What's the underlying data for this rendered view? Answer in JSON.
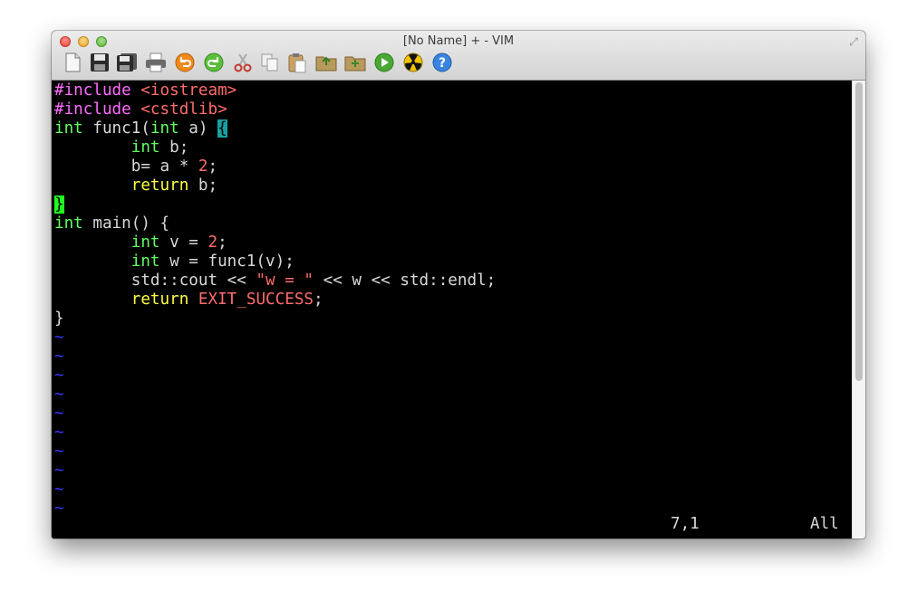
{
  "window": {
    "title": "[No Name] + - VIM"
  },
  "toolbar": {
    "buttons": [
      {
        "name": "new-file-icon"
      },
      {
        "name": "save-icon"
      },
      {
        "name": "save-all-icon"
      },
      {
        "name": "print-icon"
      },
      {
        "name": "undo-icon"
      },
      {
        "name": "redo-icon"
      },
      {
        "name": "cut-icon"
      },
      {
        "name": "copy-icon"
      },
      {
        "name": "paste-icon"
      },
      {
        "name": "open-folder-icon"
      },
      {
        "name": "new-folder-icon"
      },
      {
        "name": "run-icon"
      },
      {
        "name": "radiation-icon"
      },
      {
        "name": "help-icon"
      }
    ]
  },
  "editor": {
    "lines": [
      {
        "t": "l1a",
        "v": "#include"
      },
      {
        "t": "l1b",
        "v": " <iostream>"
      },
      {
        "t": "l2a",
        "v": "#include"
      },
      {
        "t": "l2b",
        "v": " <cstdlib>"
      },
      {
        "t": "l3a",
        "v": "int"
      },
      {
        "t": "l3b",
        "v": " func1("
      },
      {
        "t": "l3c",
        "v": "int"
      },
      {
        "t": "l3d",
        "v": " a) "
      },
      {
        "t": "l3e",
        "v": "{"
      },
      {
        "t": "l4a",
        "v": "        "
      },
      {
        "t": "l4b",
        "v": "int"
      },
      {
        "t": "l4c",
        "v": " b;"
      },
      {
        "t": "l5a",
        "v": "        b= a * "
      },
      {
        "t": "l5b",
        "v": "2"
      },
      {
        "t": "l5c",
        "v": ";"
      },
      {
        "t": "l6a",
        "v": "        "
      },
      {
        "t": "l6b",
        "v": "return"
      },
      {
        "t": "l6c",
        "v": " b;"
      },
      {
        "t": "l7a",
        "v": "}"
      },
      {
        "t": "l8a",
        "v": "int"
      },
      {
        "t": "l8b",
        "v": " main() {"
      },
      {
        "t": "l9a",
        "v": "        "
      },
      {
        "t": "l9b",
        "v": "int"
      },
      {
        "t": "l9c",
        "v": " v = "
      },
      {
        "t": "l9d",
        "v": "2"
      },
      {
        "t": "l9e",
        "v": ";"
      },
      {
        "t": "l10a",
        "v": "        "
      },
      {
        "t": "l10b",
        "v": "int"
      },
      {
        "t": "l10c",
        "v": " w = func1(v);"
      },
      {
        "t": "l11a",
        "v": "        std::cout << "
      },
      {
        "t": "l11b",
        "v": "\"w = \""
      },
      {
        "t": "l11c",
        "v": " << w << std::endl;"
      },
      {
        "t": "l12a",
        "v": "        "
      },
      {
        "t": "l12b",
        "v": "return"
      },
      {
        "t": "l12c",
        "v": " "
      },
      {
        "t": "l12d",
        "v": "EXIT_SUCCESS"
      },
      {
        "t": "l12e",
        "v": ";"
      },
      {
        "t": "l13a",
        "v": "}"
      }
    ],
    "tilde": "~",
    "empty_line_count": 10
  },
  "status": {
    "cursor_position": "7,1",
    "scroll_percent": "All"
  },
  "colors": {
    "background": "#000000",
    "preproc": "#ff6cff",
    "type": "#62ff62",
    "keyword": "#ffff42",
    "constant": "#ff6c6c",
    "match_paren": "#18a0a0",
    "cursor": "#20ff20",
    "tilde": "#3838ff"
  }
}
